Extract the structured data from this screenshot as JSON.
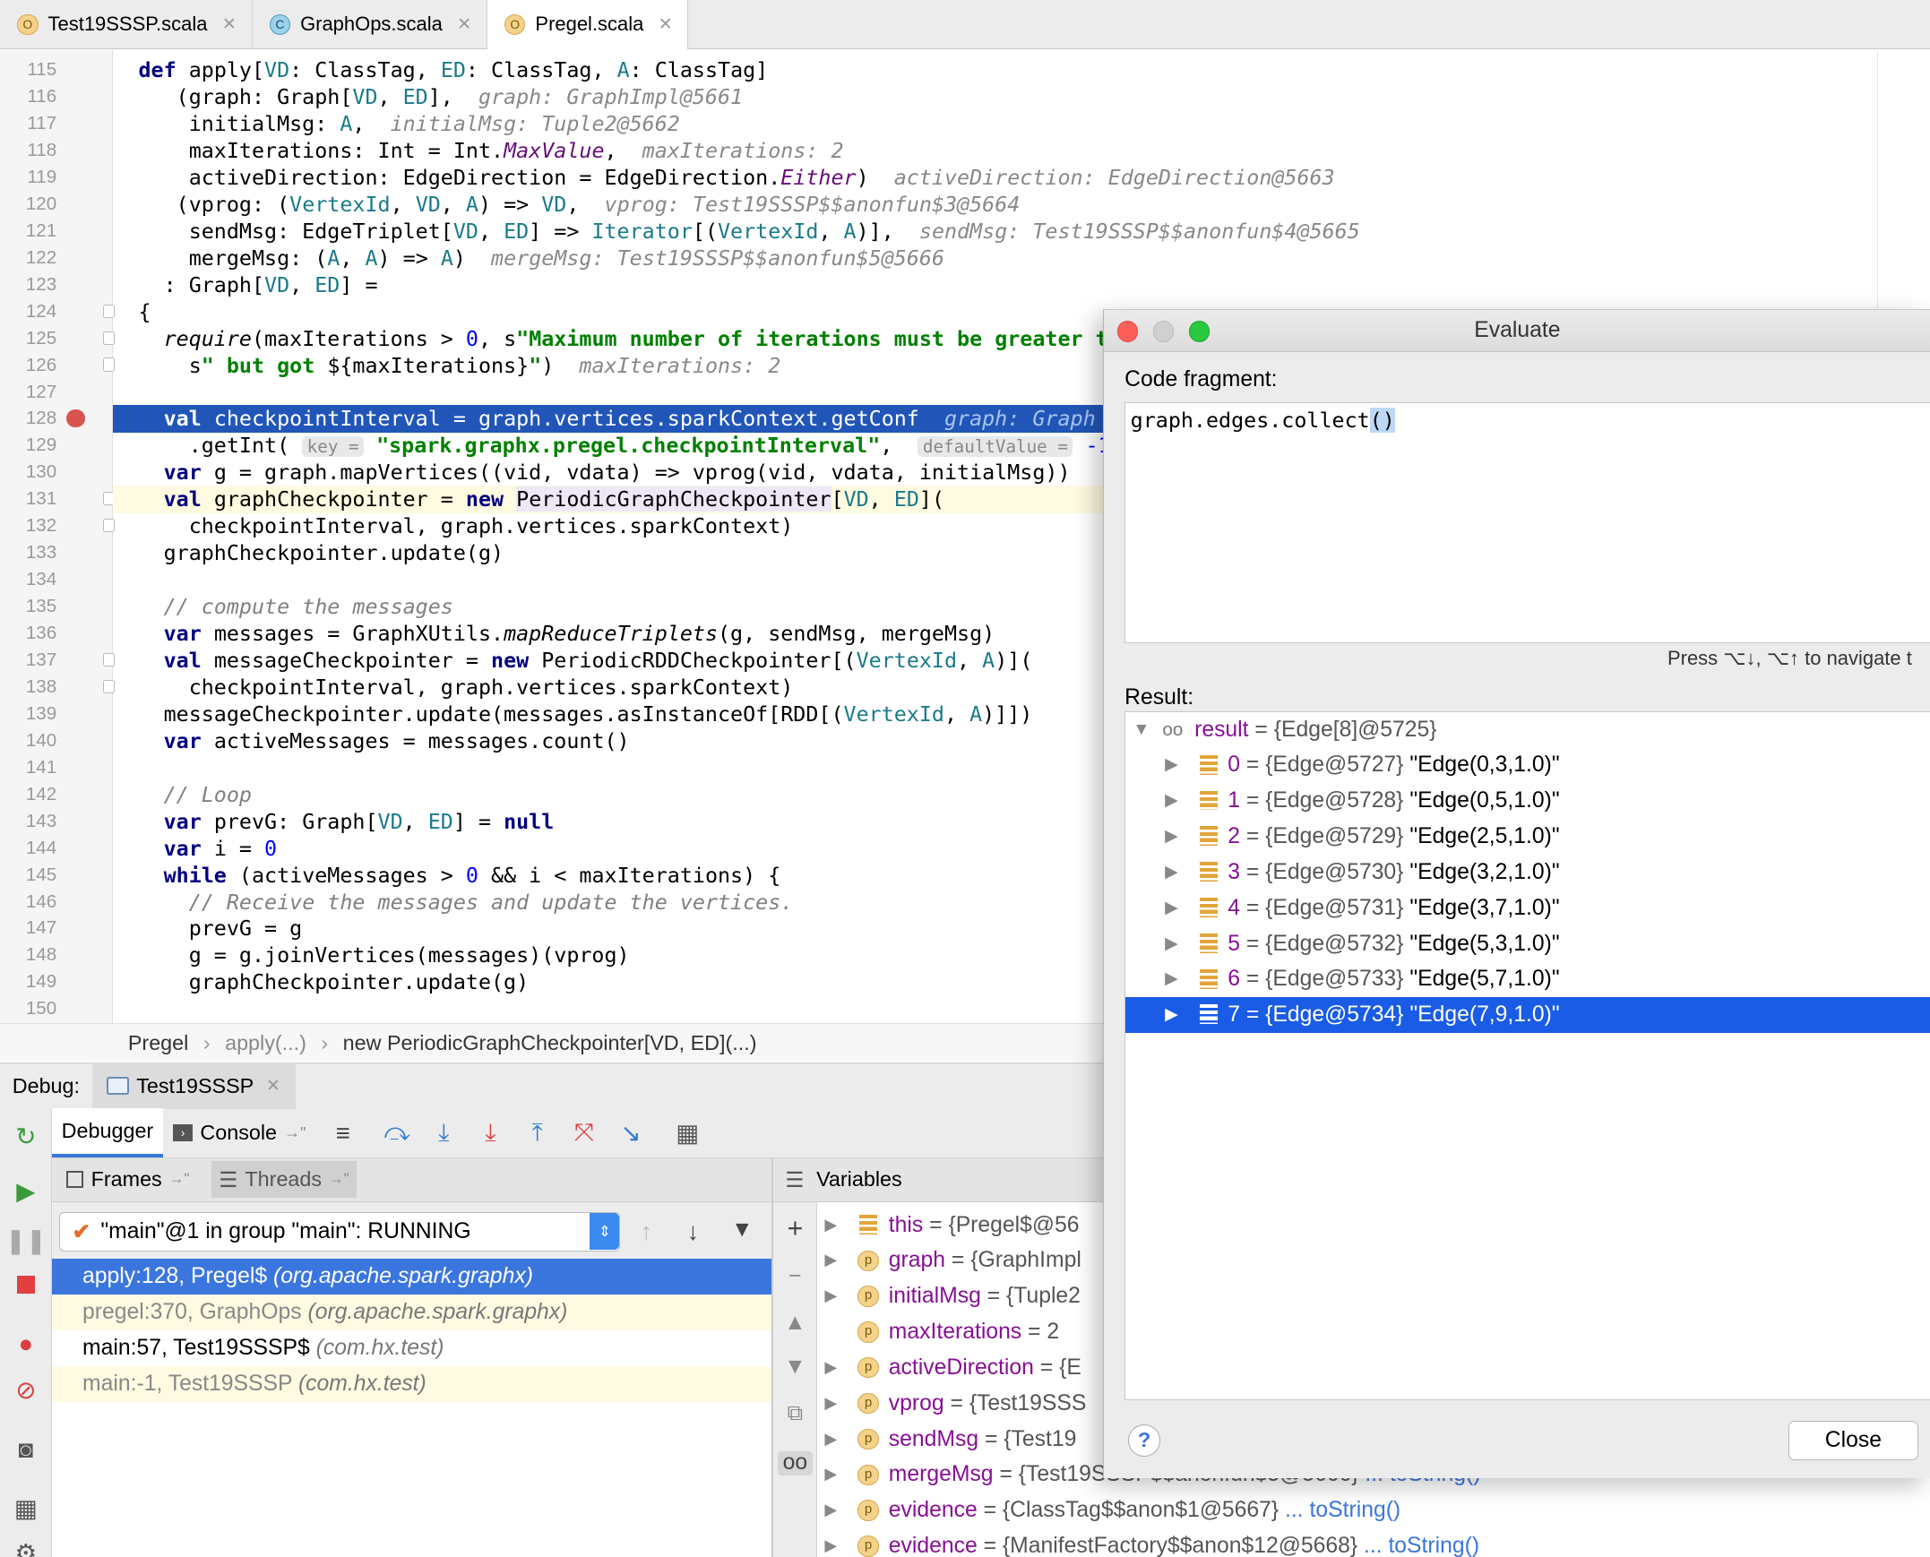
{
  "tabs": [
    {
      "name": "Test19SSSP.scala",
      "icon": "scala-object-icon"
    },
    {
      "name": "GraphOps.scala",
      "icon": "scala-class-icon"
    },
    {
      "name": "Pregel.scala",
      "icon": "scala-object-icon"
    }
  ],
  "editor": {
    "line_numbers": [
      "115",
      "116",
      "117",
      "118",
      "119",
      "120",
      "121",
      "122",
      "123",
      "124",
      "125",
      "126",
      "127",
      "128",
      "129",
      "130",
      "131",
      "132",
      "133",
      "134",
      "135",
      "136",
      "137",
      "138",
      "139",
      "140",
      "141",
      "142",
      "143",
      "144",
      "145",
      "146",
      "147",
      "148",
      "149",
      "150"
    ],
    "current_execution_line": "128",
    "breakpoint_line": "128",
    "hints": {
      "graph": "graph: GraphImpl@5661",
      "initialMsg": "initialMsg: Tuple2@5662",
      "maxIterations": "maxIterations: 2",
      "activeDirection": "activeDirection: EdgeDirection@5663",
      "vprog": "vprog: Test19SSSP$$anonfun$3@5664",
      "sendMsg": "sendMsg: Test19SSSP$$anonfun$4@5665",
      "mergeMsg": "mergeMsg: Test19SSSP$$anonfun$5@5666",
      "maxIterations2": "maxIterations: 2",
      "graph128": "graph: Graph"
    },
    "param_hints": {
      "key": "key =",
      "defaultValue": "defaultValue ="
    }
  },
  "breadcrumb": [
    "Pregel",
    "apply(...)",
    "new PeriodicGraphCheckpointer[VD, ED](...)"
  ],
  "debug": {
    "label": "Debug:",
    "session_tab": "Test19SSSP",
    "tabs": {
      "debugger": "Debugger",
      "console": "Console"
    },
    "frames_label": "Frames",
    "threads_label": "Threads",
    "variables_label": "Variables",
    "thread_selector": "\"main\"@1 in group \"main\": RUNNING",
    "frames": [
      {
        "method": "apply:128, Pregel$",
        "pkg": "(org.apache.spark.graphx)",
        "state": "selected"
      },
      {
        "method": "pregel:370, GraphOps",
        "pkg": "(org.apache.spark.graphx)",
        "state": "library"
      },
      {
        "method": "main:57, Test19SSSP$",
        "pkg": "(com.hx.test)",
        "state": "normal"
      },
      {
        "method": "main:-1, Test19SSSP",
        "pkg": "(com.hx.test)",
        "state": "library"
      }
    ],
    "variables": [
      {
        "name": "this",
        "value": "= {Pregel$@56",
        "icon": "field-icon",
        "expandable": true,
        "link": ""
      },
      {
        "name": "graph",
        "value": "= {GraphImpl",
        "icon": "parameter-icon",
        "expandable": true,
        "link": ""
      },
      {
        "name": "initialMsg",
        "value": "= {Tuple2",
        "icon": "parameter-icon",
        "expandable": true,
        "link": ""
      },
      {
        "name": "maxIterations",
        "value": "= 2",
        "icon": "parameter-icon",
        "expandable": false,
        "link": ""
      },
      {
        "name": "activeDirection",
        "value": "= {E",
        "icon": "parameter-icon",
        "expandable": true,
        "link": ""
      },
      {
        "name": "vprog",
        "value": "= {Test19SSS",
        "icon": "parameter-icon",
        "expandable": true,
        "link": ""
      },
      {
        "name": "sendMsg",
        "value": "= {Test19",
        "icon": "parameter-icon",
        "expandable": true,
        "link": ""
      },
      {
        "name": "mergeMsg",
        "value": "= {Test19SSSP$$anonfun$5@5666}",
        "icon": "parameter-icon",
        "expandable": true,
        "link": "... toString()"
      },
      {
        "name": "evidence",
        "value": "= {ClassTag$$anon$1@5667}",
        "icon": "parameter-icon",
        "expandable": true,
        "link": "... toString()"
      },
      {
        "name": "evidence",
        "value": "= {ManifestFactory$$anon$12@5668}",
        "icon": "parameter-icon",
        "expandable": true,
        "link": "... toString()"
      }
    ]
  },
  "evaluate": {
    "title": "Evaluate",
    "code_label": "Code fragment:",
    "code_text": "graph.edges.collect",
    "code_parens": "()",
    "nav_hint": "Press ⌥↓, ⌥↑ to navigate t",
    "result_label": "Result:",
    "result_root": {
      "name": "result",
      "value": "= {Edge[8]@5725}"
    },
    "result_items": [
      {
        "index": "0",
        "ref": "= {Edge@5727}",
        "str": "\"Edge(0,3,1.0)\""
      },
      {
        "index": "1",
        "ref": "= {Edge@5728}",
        "str": "\"Edge(0,5,1.0)\""
      },
      {
        "index": "2",
        "ref": "= {Edge@5729}",
        "str": "\"Edge(2,5,1.0)\""
      },
      {
        "index": "3",
        "ref": "= {Edge@5730}",
        "str": "\"Edge(3,2,1.0)\""
      },
      {
        "index": "4",
        "ref": "= {Edge@5731}",
        "str": "\"Edge(3,7,1.0)\""
      },
      {
        "index": "5",
        "ref": "= {Edge@5732}",
        "str": "\"Edge(5,3,1.0)\""
      },
      {
        "index": "6",
        "ref": "= {Edge@5733}",
        "str": "\"Edge(5,7,1.0)\""
      },
      {
        "index": "7",
        "ref": "= {Edge@5734}",
        "str": "\"Edge(7,9,1.0)\""
      }
    ],
    "selected_index": 7,
    "help": "?",
    "close_label": "Close"
  },
  "colors": {
    "exec_line": "#2156b8",
    "selection": "#1a5ce6",
    "keyword": "#000080",
    "string": "#008000"
  }
}
